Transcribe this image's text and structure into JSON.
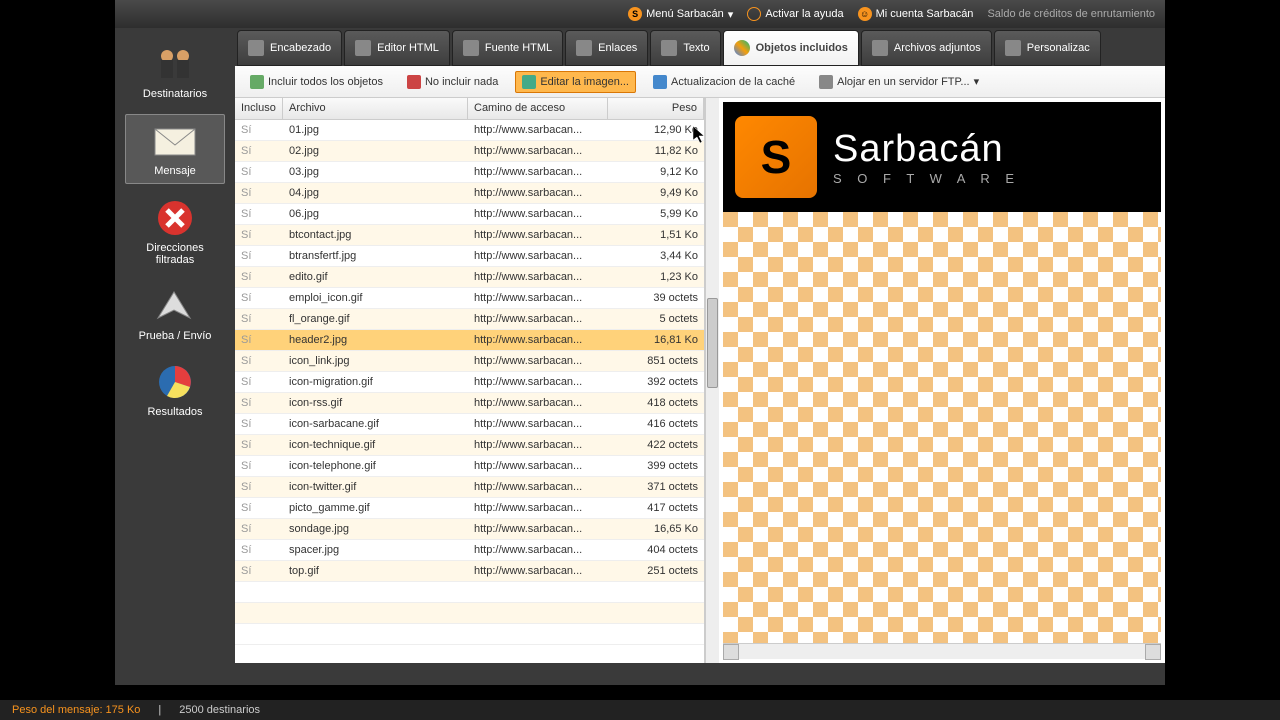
{
  "topbar": {
    "menu": "Menú Sarbacán",
    "help": "Activar la ayuda",
    "account": "Mi cuenta Sarbacán",
    "credits": "Saldo de créditos de enrutamiento"
  },
  "sidebar": [
    {
      "id": "destinatarios",
      "label": "Destinatarios"
    },
    {
      "id": "mensaje",
      "label": "Mensaje"
    },
    {
      "id": "filtradas",
      "label": "Direcciones filtradas"
    },
    {
      "id": "envio",
      "label": "Prueba / Envío"
    },
    {
      "id": "resultados",
      "label": "Resultados"
    }
  ],
  "tabs": [
    {
      "label": "Encabezado"
    },
    {
      "label": "Editor HTML"
    },
    {
      "label": "Fuente HTML"
    },
    {
      "label": "Enlaces"
    },
    {
      "label": "Texto"
    },
    {
      "label": "Objetos incluidos"
    },
    {
      "label": "Archivos adjuntos"
    },
    {
      "label": "Personalizac"
    }
  ],
  "toolbar": {
    "include_all": "Incluir todos los objetos",
    "include_none": "No incluir nada",
    "edit_image": "Editar la imagen...",
    "refresh_cache": "Actualizacion de la caché",
    "ftp_host": "Alojar en un servidor FTP..."
  },
  "columns": {
    "c0": "Incluso",
    "c1": "Archivo",
    "c2": "Camino de acceso",
    "c3": "Peso"
  },
  "rows": [
    {
      "inc": "Sí",
      "file": "01.jpg",
      "path": "http://www.sarbacan...",
      "size": "12,90 Ko"
    },
    {
      "inc": "Sí",
      "file": "02.jpg",
      "path": "http://www.sarbacan...",
      "size": "11,82 Ko"
    },
    {
      "inc": "Sí",
      "file": "03.jpg",
      "path": "http://www.sarbacan...",
      "size": "9,12 Ko"
    },
    {
      "inc": "Sí",
      "file": "04.jpg",
      "path": "http://www.sarbacan...",
      "size": "9,49 Ko"
    },
    {
      "inc": "Sí",
      "file": "06.jpg",
      "path": "http://www.sarbacan...",
      "size": "5,99 Ko"
    },
    {
      "inc": "Sí",
      "file": "btcontact.jpg",
      "path": "http://www.sarbacan...",
      "size": "1,51 Ko"
    },
    {
      "inc": "Sí",
      "file": "btransfertf.jpg",
      "path": "http://www.sarbacan...",
      "size": "3,44 Ko"
    },
    {
      "inc": "Sí",
      "file": "edito.gif",
      "path": "http://www.sarbacan...",
      "size": "1,23 Ko"
    },
    {
      "inc": "Sí",
      "file": "emploi_icon.gif",
      "path": "http://www.sarbacan...",
      "size": "39 octets"
    },
    {
      "inc": "Sí",
      "file": "fl_orange.gif",
      "path": "http://www.sarbacan...",
      "size": "5 octets"
    },
    {
      "inc": "Sí",
      "file": "header2.jpg",
      "path": "http://www.sarbacan...",
      "size": "16,81 Ko",
      "sel": true
    },
    {
      "inc": "Sí",
      "file": "icon_link.jpg",
      "path": "http://www.sarbacan...",
      "size": "851 octets"
    },
    {
      "inc": "Sí",
      "file": "icon-migration.gif",
      "path": "http://www.sarbacan...",
      "size": "392 octets"
    },
    {
      "inc": "Sí",
      "file": "icon-rss.gif",
      "path": "http://www.sarbacan...",
      "size": "418 octets"
    },
    {
      "inc": "Sí",
      "file": "icon-sarbacane.gif",
      "path": "http://www.sarbacan...",
      "size": "416 octets"
    },
    {
      "inc": "Sí",
      "file": "icon-technique.gif",
      "path": "http://www.sarbacan...",
      "size": "422 octets"
    },
    {
      "inc": "Sí",
      "file": "icon-telephone.gif",
      "path": "http://www.sarbacan...",
      "size": "399 octets"
    },
    {
      "inc": "Sí",
      "file": "icon-twitter.gif",
      "path": "http://www.sarbacan...",
      "size": "371 octets"
    },
    {
      "inc": "Sí",
      "file": "picto_gamme.gif",
      "path": "http://www.sarbacan...",
      "size": "417 octets"
    },
    {
      "inc": "Sí",
      "file": "sondage.jpg",
      "path": "http://www.sarbacan...",
      "size": "16,65 Ko"
    },
    {
      "inc": "Sí",
      "file": "spacer.jpg",
      "path": "http://www.sarbacan...",
      "size": "404 octets"
    },
    {
      "inc": "Sí",
      "file": "top.gif",
      "path": "http://www.sarbacan...",
      "size": "251 octets"
    }
  ],
  "preview": {
    "brand_big": "Sarbacán",
    "brand_small": "S O F T W A R E"
  },
  "status": {
    "weight": "Peso del mensaje: 175 Ko",
    "recipients": "2500 destinarios"
  }
}
